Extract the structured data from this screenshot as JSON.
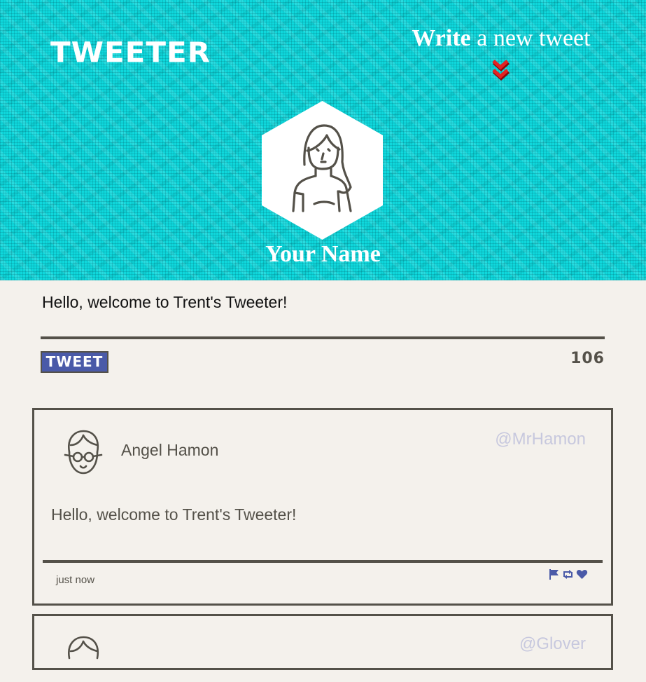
{
  "header": {
    "brand": "TWEETER",
    "compose_bold": "Write",
    "compose_rest": " a new tweet",
    "profile_name": "Your Name",
    "background_color": "#0fd8dc"
  },
  "compose": {
    "text": "Hello, welcome to Trent's Tweeter!",
    "button_label": "TWEET",
    "char_count": "106",
    "button_color": "#4a5aa8"
  },
  "tweets": [
    {
      "name": "Angel Hamon",
      "handle": "@MrHamon",
      "text": "Hello, welcome to Trent's Tweeter!",
      "time": "just now",
      "actions": [
        "flag-icon",
        "retweet-icon",
        "heart-icon"
      ]
    },
    {
      "handle": "@Glover"
    }
  ]
}
